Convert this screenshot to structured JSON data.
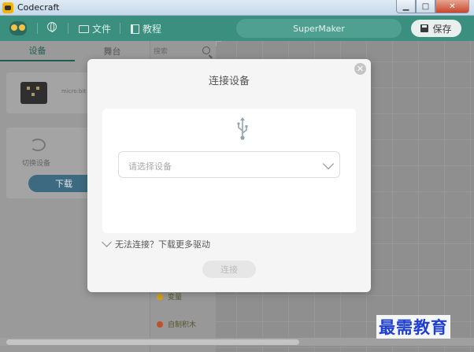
{
  "window": {
    "title": "Codecraft"
  },
  "appbar": {
    "file_label": "文件",
    "tutorial_label": "教程",
    "device_name": "SuperMaker",
    "save_label": "保存"
  },
  "left_panel": {
    "tabs": [
      {
        "label": "设备"
      },
      {
        "label": "舞台"
      }
    ],
    "device_label": "micro:bit",
    "switch_label": "切换设备",
    "download_label": "下载"
  },
  "palette": {
    "search_placeholder": "搜索",
    "items": [
      {
        "label": "变量",
        "color": "#d4a017"
      },
      {
        "label": "自制积木",
        "color": "#c0522a"
      }
    ]
  },
  "modal": {
    "title": "连接设备",
    "select_placeholder": "请选择设备",
    "driver_link": "无法连接？下载更多驱动",
    "connect_label": "连接"
  },
  "watermark": "最需教育",
  "colors": {
    "accent": "#3a8f7f",
    "modal_bg": "#f5f5f5"
  }
}
